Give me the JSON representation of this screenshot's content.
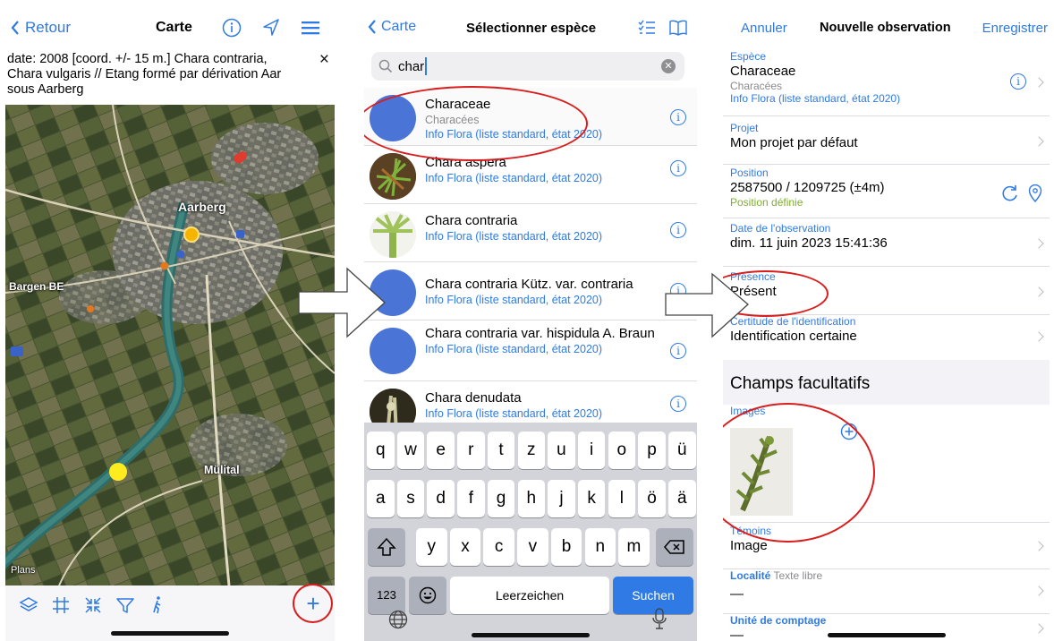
{
  "screen1": {
    "back_label": "Retour",
    "title": "Carte",
    "info_text": "date: 2008 [coord. +/- 15 m.] Chara contraria, Chara vulgaris // Etang formé par dérivation Aar sous Aarberg",
    "close_glyph": "×",
    "map_labels": [
      "Aarberg",
      "Bargen BE",
      "Mülital"
    ],
    "attribution": "Plans",
    "add_glyph": "+"
  },
  "screen2": {
    "back_label": "Carte",
    "title": "Sélectionner espèce",
    "search_value": "char",
    "results": [
      {
        "name": "Characeae",
        "sub": "Characées",
        "source": "Info Flora (liste standard, état 2020)"
      },
      {
        "name": "Chara aspera",
        "sub": "",
        "source": "Info Flora (liste standard, état 2020)"
      },
      {
        "name": "Chara contraria",
        "sub": "",
        "source": "Info Flora (liste standard, état 2020)"
      },
      {
        "name": "Chara contraria Kütz. var. contraria",
        "sub": "",
        "source": "Info Flora (liste standard, état 2020)"
      },
      {
        "name": "Chara contraria var. hispidula A. Braun",
        "sub": "",
        "source": "Info Flora (liste standard, état 2020)"
      },
      {
        "name": "Chara denudata",
        "sub": "",
        "source": "Info Flora (liste standard, état 2020)"
      }
    ],
    "keyboard": {
      "row1": [
        "q",
        "w",
        "e",
        "r",
        "t",
        "z",
        "u",
        "i",
        "o",
        "p",
        "ü"
      ],
      "row2": [
        "a",
        "s",
        "d",
        "f",
        "g",
        "h",
        "j",
        "k",
        "l",
        "ö",
        "ä"
      ],
      "row3": [
        "y",
        "x",
        "c",
        "v",
        "b",
        "n",
        "m"
      ],
      "numbers_key": "123",
      "space_key": "Leerzeichen",
      "go_key": "Suchen"
    }
  },
  "screen3": {
    "cancel_label": "Annuler",
    "title": "Nouvelle observation",
    "save_label": "Enregistrer",
    "species": {
      "label": "Espèce",
      "value": "Characeae",
      "sub": "Characées",
      "source": "Info Flora (liste standard, état 2020)"
    },
    "project": {
      "label": "Projet",
      "value": "Mon projet par défaut"
    },
    "position": {
      "label": "Position",
      "value": "2587500 / 1209725 (±4m)",
      "status": "Position définie"
    },
    "date": {
      "label": "Date de l'observation",
      "value": "dim. 11 juin 2023 15:41:36"
    },
    "presence": {
      "label": "Présence",
      "value": "Présent"
    },
    "certainty": {
      "label": "Certitude de l'identification",
      "value": "Identification certaine"
    },
    "optional_header": "Champs facultatifs",
    "images_label": "Images",
    "witness": {
      "label": "Témoins",
      "value": "Image"
    },
    "locality": {
      "label": "Localité",
      "hint": "Texte libre",
      "value": "—"
    },
    "unit": {
      "label": "Unité de comptage",
      "value": "—"
    }
  },
  "colors": {
    "accent": "#2f7ae5",
    "annotation": "#d81e1e",
    "marker_orange": "#f5b400",
    "marker_yellow": "#ffeb1e"
  }
}
